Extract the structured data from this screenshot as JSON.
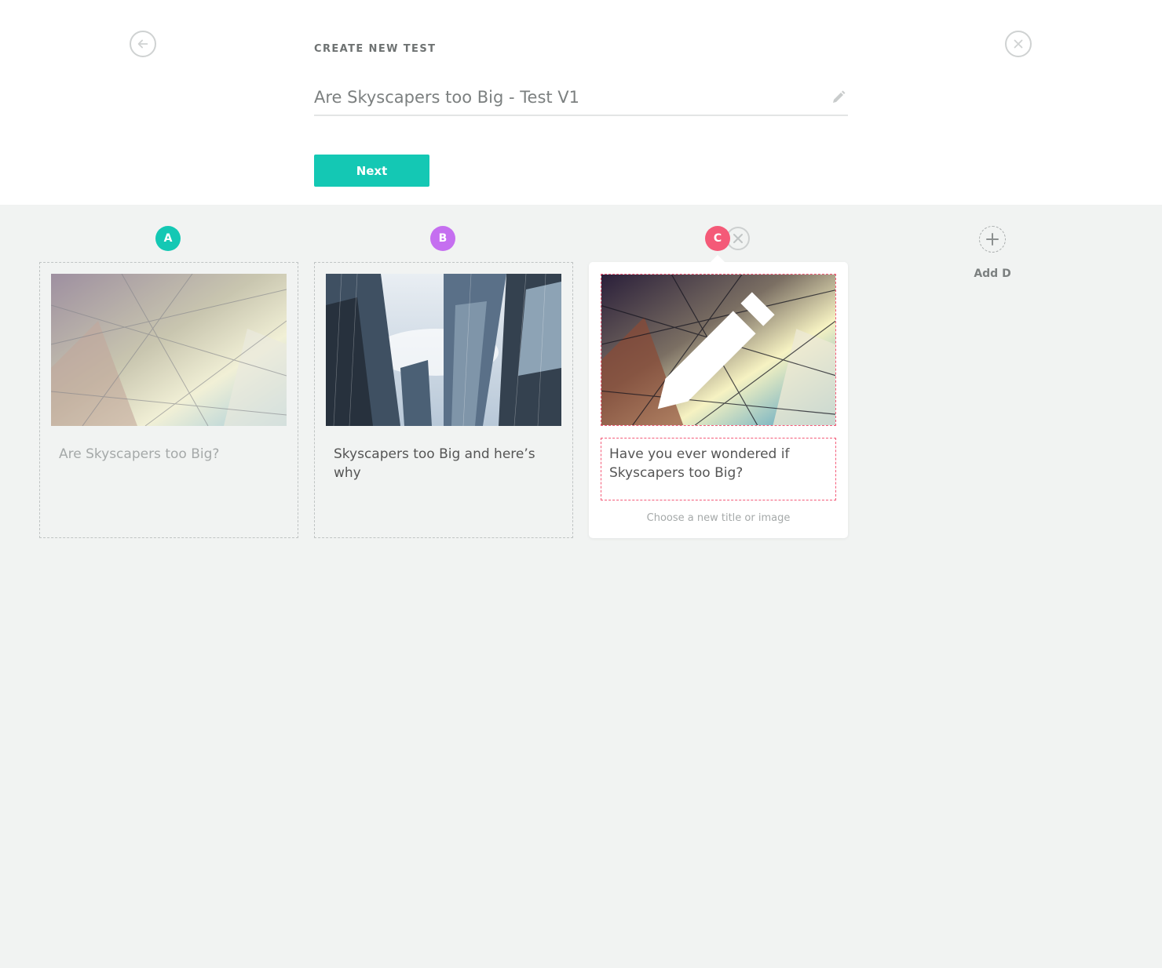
{
  "header": {
    "heading": "CREATE NEW TEST",
    "test_title": "Are Skyscapers too Big - Test V1",
    "next_label": "Next",
    "back_icon": "arrow-left-circle-icon",
    "close_icon": "close-circle-icon",
    "edit_icon": "pencil-icon"
  },
  "variants": [
    {
      "letter": "A",
      "color": "#14c8b4",
      "title": "Are Skyscapers too Big?",
      "state": "inactive"
    },
    {
      "letter": "B",
      "color": "#c56ff0",
      "title": "Skyscapers too Big and here’s why",
      "state": "normal"
    },
    {
      "letter": "C",
      "color": "#f45a78",
      "title": "Have you ever wondered if Skyscapers too Big?",
      "state": "editing",
      "hint": "Choose a new title or image"
    }
  ],
  "add_variant": {
    "label": "Add D",
    "icon": "plus-circle-icon"
  },
  "colors": {
    "accent": "#14c8b4",
    "background": "#f1f3f2",
    "edit_border": "#f45a78"
  }
}
